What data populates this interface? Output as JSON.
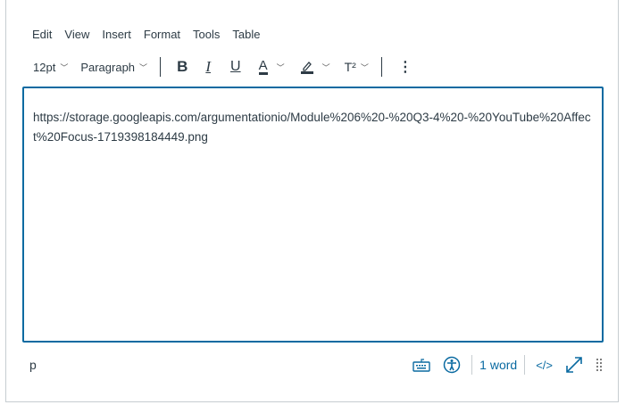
{
  "menubar": {
    "items": [
      "Edit",
      "View",
      "Insert",
      "Format",
      "Tools",
      "Table"
    ]
  },
  "toolbar": {
    "font_size": "12pt",
    "block_format": "Paragraph",
    "bold": "B",
    "italic": "I",
    "underline": "U",
    "text_color": "A",
    "superscript": "T²",
    "more": "⋮"
  },
  "editor": {
    "content": "https://storage.googleapis.com/argumentationio/Module%206%20-%20Q3-4%20-%20YouTube%20Affect%20Focus-1719398184449.png"
  },
  "statusbar": {
    "path": "p",
    "word_count": "1 word",
    "code_view": "</>"
  },
  "colors": {
    "accent": "#0a6aa1",
    "text": "#2d3b45"
  }
}
